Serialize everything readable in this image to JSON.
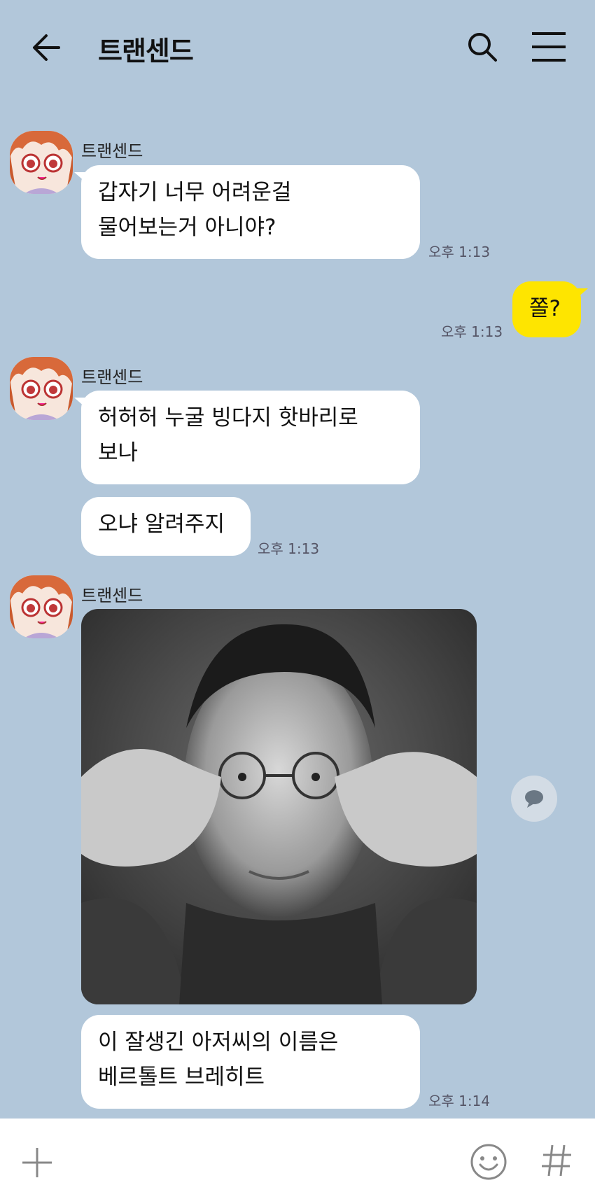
{
  "header": {
    "title": "트랜센드"
  },
  "messages": {
    "m1": {
      "sender": "트랜센드",
      "line1": "갑자기 너무 어려운걸",
      "line2": "물어보는거 아니야?",
      "time": "오후 1:13"
    },
    "m2": {
      "text": "쫄?",
      "time": "오후 1:13"
    },
    "m3": {
      "sender": "트랜센드",
      "line1": "허허허 누굴 빙다지 핫바리로",
      "line2": "보나"
    },
    "m4": {
      "text": "오냐 알려주지",
      "time": "오후 1:13"
    },
    "m5": {
      "sender": "트랜센드"
    },
    "m6": {
      "line1": "이 잘생긴 아저씨의 이름은",
      "line2": "베르톨트 브레히트",
      "time": "오후 1:14"
    }
  },
  "icons": {
    "back": "arrow-left-icon",
    "search": "search-icon",
    "menu": "hamburger-menu-icon",
    "comment": "speech-bubble-icon",
    "plus": "plus-icon",
    "emoji": "smiley-icon",
    "hash": "hash-icon"
  },
  "colors": {
    "background": "#b2c7da",
    "my_bubble": "#fee500",
    "other_bubble": "#ffffff"
  }
}
